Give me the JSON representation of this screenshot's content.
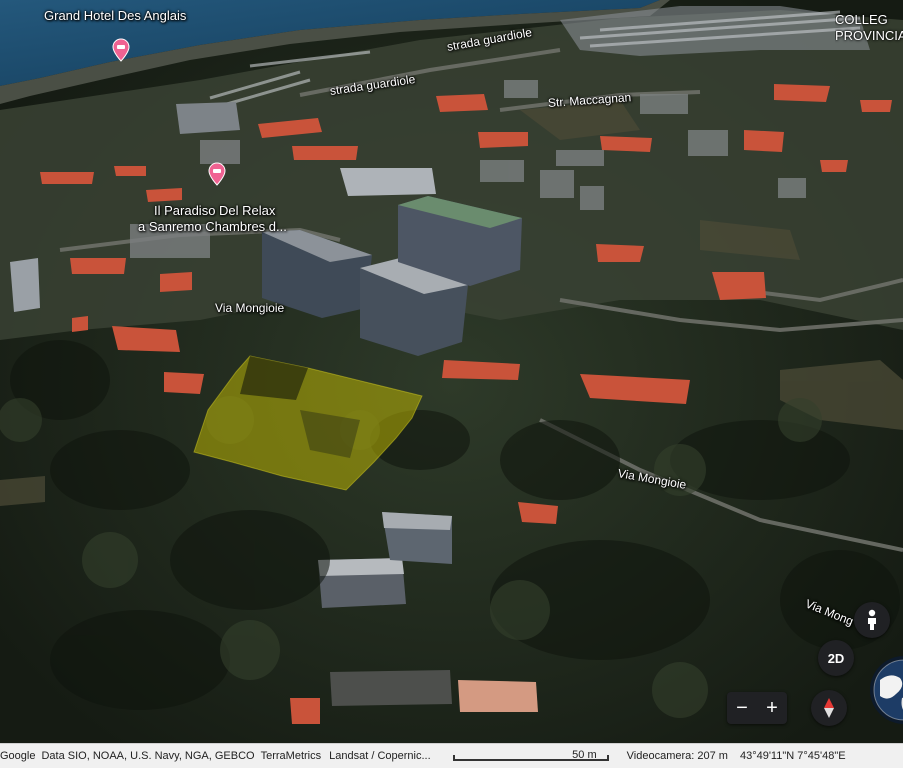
{
  "map": {
    "labels": {
      "poi_hotel": "Grand Hotel Des Anglais",
      "poi_relax_line1": "Il Paradiso Del Relax",
      "poi_relax_line2": "a Sanremo Chambres d...",
      "street_guardiole_1": "strada guardiole",
      "street_guardiole_2": "strada guardiole",
      "street_maccagnan": "Str. Maccagnan",
      "street_mongioie_1": "Via Mongioie",
      "street_mongioie_2": "Via Mongioie",
      "street_mongioie_3": "Via Mong",
      "college_line1": "COLLEG",
      "college_line2": "PROVINCIA"
    },
    "icons": {
      "poi_pin": "hotel-pin-icon",
      "pegman": "pegman-icon",
      "compass": "compass-icon",
      "globe": "globe-icon"
    },
    "colors": {
      "poi_pin": "#f06292",
      "highlight_area": "#c8c000",
      "sea": "#1d4d6e",
      "roof": "#c9533a"
    },
    "controls": {
      "view_toggle": "2D",
      "zoom_out": "−",
      "zoom_in": "+"
    }
  },
  "footer": {
    "google": "Google",
    "data_credits": "Data SIO, NOAA, U.S. Navy, NGA, GEBCO",
    "terrametrics": "TerraMetrics",
    "landsat": "Landsat / Copernic...",
    "scale_label": "50 m",
    "camera": "Videocamera: 207 m",
    "coordinates": "43°49'11\"N 7°45'48\"E"
  }
}
